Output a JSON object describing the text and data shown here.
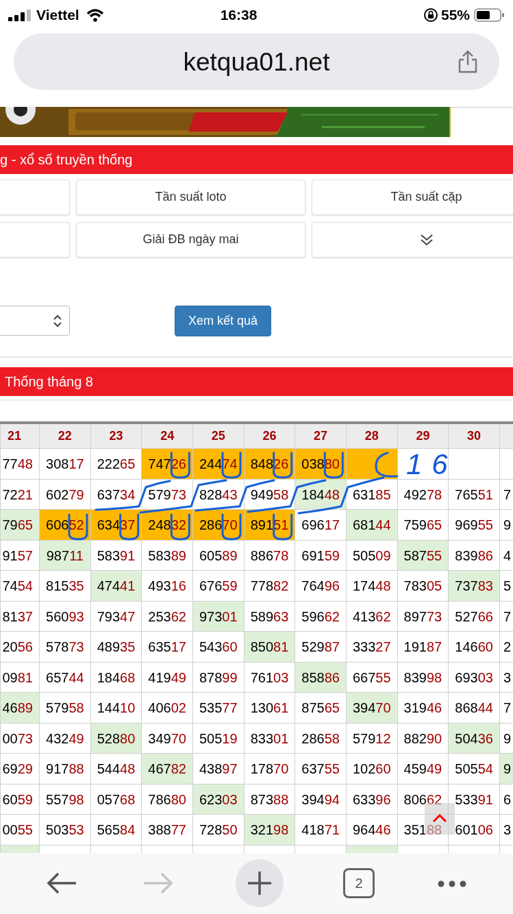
{
  "status_bar": {
    "carrier": "Viettel",
    "time": "16:38",
    "battery": "55%"
  },
  "address_bar": {
    "url": "ketqua01.net"
  },
  "section_title": "g - xổ số truyền thống",
  "menu_buttons": [
    {
      "kind": "blank"
    },
    {
      "kind": "text",
      "label": "Tần suất loto"
    },
    {
      "kind": "text",
      "label": "Tần suất cặp"
    },
    {
      "kind": "blank"
    },
    {
      "kind": "text",
      "label": "Giải ĐB ngày mai"
    },
    {
      "kind": "expand"
    }
  ],
  "submit_button": "Xem kết quả",
  "table_title": "Thống tháng 8",
  "table": {
    "columns": [
      {
        "label": "21"
      },
      {
        "label": "22"
      },
      {
        "label": "23"
      },
      {
        "label": "24"
      },
      {
        "label": "25"
      },
      {
        "label": "26"
      },
      {
        "label": "27"
      },
      {
        "label": "28"
      },
      {
        "label": "29"
      },
      {
        "label": "30"
      },
      {
        "kind": "cut"
      }
    ],
    "rows": [
      {
        "cells": [
          {
            "head": "77",
            "tail": "48"
          },
          {
            "head": "308",
            "tail": "17"
          },
          {
            "head": "222",
            "tail": "65"
          },
          {
            "head": "747",
            "tail": "26",
            "color": "#ffb800"
          },
          {
            "head": "244",
            "tail": "74",
            "color": "#ffb800"
          },
          {
            "head": "848",
            "tail": "26",
            "color": "#ffb800"
          },
          {
            "head": "038",
            "tail": "80",
            "color": "#ffb800"
          },
          {
            "color": "#ffb800"
          },
          {},
          {},
          {}
        ]
      },
      {
        "cells": [
          {
            "head": "72",
            "tail": "21"
          },
          {
            "head": "602",
            "tail": "79"
          },
          {
            "head": "637",
            "tail": "34"
          },
          {
            "head": "579",
            "tail": "73"
          },
          {
            "head": "828",
            "tail": "43"
          },
          {
            "head": "949",
            "tail": "58"
          },
          {
            "head": "184",
            "tail": "48",
            "color": "#dff0d8"
          },
          {
            "head": "631",
            "tail": "85"
          },
          {
            "head": "492",
            "tail": "78"
          },
          {
            "head": "765",
            "tail": "51"
          },
          {
            "head": "7"
          }
        ]
      },
      {
        "cells": [
          {
            "head": "79",
            "tail": "65",
            "color": "#dff0d8"
          },
          {
            "head": "606",
            "tail": "52",
            "color": "#ffb800"
          },
          {
            "head": "634",
            "tail": "37",
            "color": "#ffb800"
          },
          {
            "head": "248",
            "tail": "32",
            "color": "#ffb800"
          },
          {
            "head": "286",
            "tail": "70",
            "color": "#ffb800"
          },
          {
            "head": "891",
            "tail": "51",
            "color": "#ffb800"
          },
          {
            "head": "696",
            "tail": "17"
          },
          {
            "head": "681",
            "tail": "44",
            "color": "#dff0d8"
          },
          {
            "head": "759",
            "tail": "65"
          },
          {
            "head": "969",
            "tail": "55"
          },
          {
            "head": "9"
          }
        ]
      },
      {
        "cells": [
          {
            "head": "91",
            "tail": "57"
          },
          {
            "head": "987",
            "tail": "11",
            "color": "#dff0d8"
          },
          {
            "head": "583",
            "tail": "91"
          },
          {
            "head": "583",
            "tail": "89"
          },
          {
            "head": "605",
            "tail": "89"
          },
          {
            "head": "886",
            "tail": "78"
          },
          {
            "head": "691",
            "tail": "59"
          },
          {
            "head": "505",
            "tail": "09"
          },
          {
            "head": "587",
            "tail": "55",
            "color": "#dff0d8"
          },
          {
            "head": "839",
            "tail": "86"
          },
          {
            "head": "4"
          }
        ]
      },
      {
        "cells": [
          {
            "head": "74",
            "tail": "54"
          },
          {
            "head": "815",
            "tail": "35"
          },
          {
            "head": "474",
            "tail": "41",
            "color": "#dff0d8"
          },
          {
            "head": "493",
            "tail": "16"
          },
          {
            "head": "676",
            "tail": "59"
          },
          {
            "head": "778",
            "tail": "82"
          },
          {
            "head": "764",
            "tail": "96"
          },
          {
            "head": "174",
            "tail": "48"
          },
          {
            "head": "783",
            "tail": "05"
          },
          {
            "head": "737",
            "tail": "83",
            "color": "#dff0d8"
          },
          {
            "head": "5"
          }
        ]
      },
      {
        "cells": [
          {
            "head": "81",
            "tail": "37"
          },
          {
            "head": "560",
            "tail": "93"
          },
          {
            "head": "793",
            "tail": "47"
          },
          {
            "head": "253",
            "tail": "62"
          },
          {
            "head": "973",
            "tail": "01",
            "color": "#dff0d8"
          },
          {
            "head": "589",
            "tail": "63"
          },
          {
            "head": "596",
            "tail": "62"
          },
          {
            "head": "413",
            "tail": "62"
          },
          {
            "head": "897",
            "tail": "73"
          },
          {
            "head": "527",
            "tail": "66"
          },
          {
            "head": "7"
          }
        ]
      },
      {
        "cells": [
          {
            "head": "20",
            "tail": "56"
          },
          {
            "head": "578",
            "tail": "73"
          },
          {
            "head": "489",
            "tail": "35"
          },
          {
            "head": "635",
            "tail": "17"
          },
          {
            "head": "543",
            "tail": "60"
          },
          {
            "head": "850",
            "tail": "81",
            "color": "#dff0d8"
          },
          {
            "head": "529",
            "tail": "87"
          },
          {
            "head": "333",
            "tail": "27"
          },
          {
            "head": "191",
            "tail": "87"
          },
          {
            "head": "146",
            "tail": "60"
          },
          {
            "head": "2"
          }
        ]
      },
      {
        "cells": [
          {
            "head": "09",
            "tail": "81"
          },
          {
            "head": "657",
            "tail": "44"
          },
          {
            "head": "184",
            "tail": "68"
          },
          {
            "head": "419",
            "tail": "49"
          },
          {
            "head": "878",
            "tail": "99"
          },
          {
            "head": "761",
            "tail": "03"
          },
          {
            "head": "858",
            "tail": "86",
            "color": "#dff0d8"
          },
          {
            "head": "667",
            "tail": "55"
          },
          {
            "head": "839",
            "tail": "98"
          },
          {
            "head": "693",
            "tail": "03"
          },
          {
            "head": "3"
          }
        ]
      },
      {
        "cells": [
          {
            "head": "46",
            "tail": "89",
            "color": "#dff0d8"
          },
          {
            "head": "579",
            "tail": "58"
          },
          {
            "head": "144",
            "tail": "10"
          },
          {
            "head": "406",
            "tail": "02"
          },
          {
            "head": "535",
            "tail": "77"
          },
          {
            "head": "130",
            "tail": "61"
          },
          {
            "head": "875",
            "tail": "65"
          },
          {
            "head": "394",
            "tail": "70",
            "color": "#dff0d8"
          },
          {
            "head": "319",
            "tail": "46"
          },
          {
            "head": "868",
            "tail": "44"
          },
          {
            "head": "7"
          }
        ]
      },
      {
        "cells": [
          {
            "head": "00",
            "tail": "73"
          },
          {
            "head": "432",
            "tail": "49"
          },
          {
            "head": "528",
            "tail": "80",
            "color": "#dff0d8"
          },
          {
            "head": "349",
            "tail": "70"
          },
          {
            "head": "505",
            "tail": "19"
          },
          {
            "head": "833",
            "tail": "01"
          },
          {
            "head": "286",
            "tail": "58"
          },
          {
            "head": "579",
            "tail": "12"
          },
          {
            "head": "882",
            "tail": "90"
          },
          {
            "head": "504",
            "tail": "36",
            "color": "#dff0d8"
          },
          {
            "head": "9"
          }
        ]
      },
      {
        "cells": [
          {
            "head": "69",
            "tail": "29"
          },
          {
            "head": "917",
            "tail": "88"
          },
          {
            "head": "544",
            "tail": "48"
          },
          {
            "head": "467",
            "tail": "82",
            "color": "#dff0d8"
          },
          {
            "head": "438",
            "tail": "97"
          },
          {
            "head": "178",
            "tail": "70"
          },
          {
            "head": "637",
            "tail": "55"
          },
          {
            "head": "102",
            "tail": "60"
          },
          {
            "head": "459",
            "tail": "49"
          },
          {
            "head": "505",
            "tail": "54"
          },
          {
            "head": "9",
            "color": "#dff0d8"
          }
        ]
      },
      {
        "cells": [
          {
            "head": "60",
            "tail": "59"
          },
          {
            "head": "557",
            "tail": "98"
          },
          {
            "head": "057",
            "tail": "68"
          },
          {
            "head": "786",
            "tail": "80"
          },
          {
            "head": "623",
            "tail": "03",
            "color": "#dff0d8"
          },
          {
            "head": "873",
            "tail": "88"
          },
          {
            "head": "394",
            "tail": "94"
          },
          {
            "head": "633",
            "tail": "96"
          },
          {
            "head": "806",
            "tail": "62"
          },
          {
            "head": "533",
            "tail": "91"
          },
          {
            "head": "6"
          }
        ]
      },
      {
        "cells": [
          {
            "head": "00",
            "tail": "55"
          },
          {
            "head": "503",
            "tail": "53"
          },
          {
            "head": "565",
            "tail": "84"
          },
          {
            "head": "388",
            "tail": "77"
          },
          {
            "head": "728",
            "tail": "50"
          },
          {
            "head": "321",
            "tail": "98",
            "color": "#dff0d8"
          },
          {
            "head": "418",
            "tail": "71"
          },
          {
            "head": "964",
            "tail": "46"
          },
          {
            "head": "351",
            "tail": "88"
          },
          {
            "head": "601",
            "tail": "06"
          },
          {
            "head": "3"
          }
        ]
      },
      {
        "cells": [
          {
            "color": "#dff0d8"
          },
          {},
          {},
          {},
          {},
          {},
          {},
          {
            "color": "#dff0d8"
          },
          {},
          {},
          {}
        ]
      }
    ]
  },
  "annotation": {
    "text": "16"
  },
  "bottom_toolbar": {
    "back": {
      "disabled": false
    },
    "forward": {
      "disabled": true
    },
    "tab_count": "2"
  }
}
